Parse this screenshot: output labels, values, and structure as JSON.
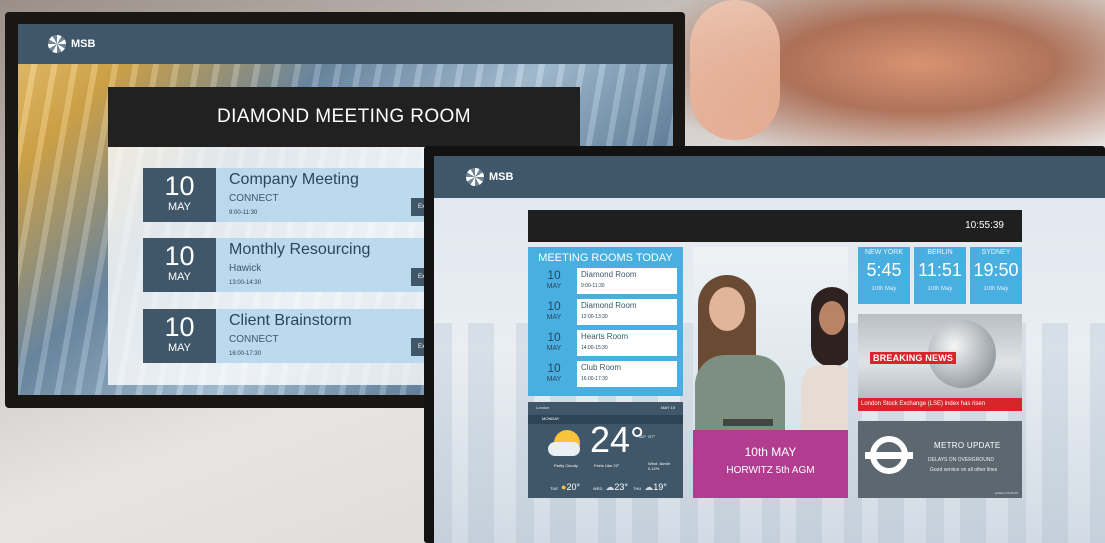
{
  "screen1": {
    "brand": "MSB",
    "title": "DIAMOND MEETING ROOM",
    "events": [
      {
        "day": "10",
        "month": "MAY",
        "title": "Company Meeting",
        "location": "CONNECT",
        "time": "9:00-11:30"
      },
      {
        "day": "10",
        "month": "MAY",
        "title": "Monthly Resourcing",
        "location": "Hawick",
        "time": "13:00-14:30"
      },
      {
        "day": "10",
        "month": "MAY",
        "title": "Client Brainstorm",
        "location": "CONNECT",
        "time": "16:00-17:30"
      }
    ],
    "button_label": "Ex"
  },
  "screen2": {
    "brand": "MSB",
    "clock": "10:55:39",
    "meeting_rooms": {
      "title": "MEETING ROOMS TODAY",
      "rows": [
        {
          "day": "10",
          "month": "MAY",
          "room": "Diamond Room",
          "time": "9:00-11:30"
        },
        {
          "day": "10",
          "month": "MAY",
          "room": "Diamond Room",
          "time": "12:00-13:30"
        },
        {
          "day": "10",
          "month": "MAY",
          "room": "Hearts Room",
          "time": "14:00-15:30"
        },
        {
          "day": "10",
          "month": "MAY",
          "room": "Club Room",
          "time": "16:00-17:30"
        }
      ]
    },
    "weather": {
      "location": "London",
      "date": "MAY 10",
      "day": "MONDAY",
      "temp": "24°",
      "range": "↓20° ↑27°",
      "condition": "Partly Cloudy",
      "feels": "Feels Like 22°",
      "wind_line1": "Wind: 4km/h",
      "wind_line2": "0.12%",
      "forecast": [
        {
          "day": "TUE",
          "temp": "20°"
        },
        {
          "day": "WED",
          "temp": "23°"
        },
        {
          "day": "THU",
          "temp": "19°"
        }
      ]
    },
    "event_card": {
      "date": "10th MAY",
      "title": "HORWITZ 5th AGM"
    },
    "clocks": [
      {
        "city": "NEW YORK",
        "time": "5:45",
        "date": "10th May"
      },
      {
        "city": "BERLIN",
        "time": "11:51",
        "date": "10th May"
      },
      {
        "city": "SYDNEY",
        "time": "19:50",
        "date": "10th May"
      }
    ],
    "news": {
      "label": "BREAKING NEWS",
      "ticker": "London Stock Exchange (LSE) index has risen"
    },
    "metro": {
      "title": "METRO UPDATE",
      "line1": "DELAYS ON OVERGROUND",
      "line2": "Good service on all other lines",
      "updated": "updated 10:55:29"
    }
  },
  "colors": {
    "brand_slate": "#3f5769",
    "tile_blue": "#49aee0",
    "agm_magenta": "#b23c90",
    "news_red": "#d8242b"
  }
}
